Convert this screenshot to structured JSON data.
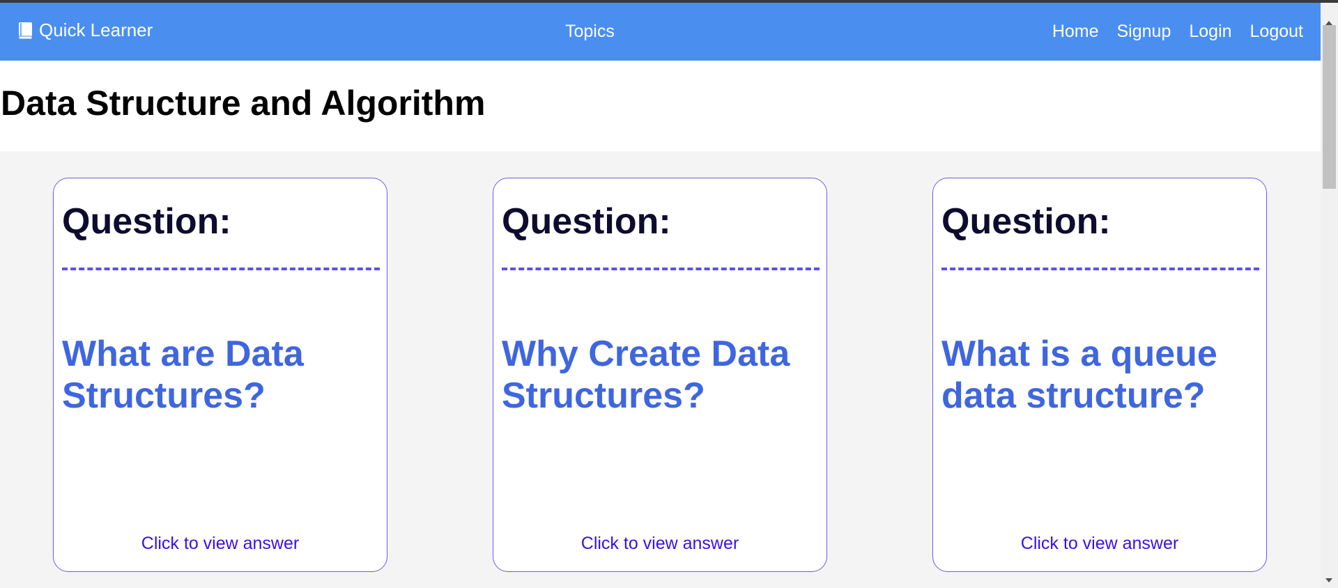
{
  "navbar": {
    "brand_label": "Quick Learner",
    "brand_icon": "book-icon",
    "center_link": "Topics",
    "right_links": [
      "Home",
      "Signup",
      "Login",
      "Logout"
    ],
    "background_color": "#4a8ef0"
  },
  "page": {
    "title": "Data Structure and Algorithm"
  },
  "cards": [
    {
      "heading": "Question:",
      "divider": "----------------------------------",
      "question": "What are Data Structures?",
      "link": "Click to view answer"
    },
    {
      "heading": "Question:",
      "divider": "----------------------------------",
      "question": "Why Create Data Structures?",
      "link": "Click to view answer"
    },
    {
      "heading": "Question:",
      "divider": "----------------------------------",
      "question": "What is a queue data structure?",
      "link": "Click to view answer"
    }
  ],
  "colors": {
    "question_text": "#3f66df",
    "link_text": "#3a10e6",
    "card_border": "#6b5ce7",
    "content_background": "#f4f4f4"
  }
}
